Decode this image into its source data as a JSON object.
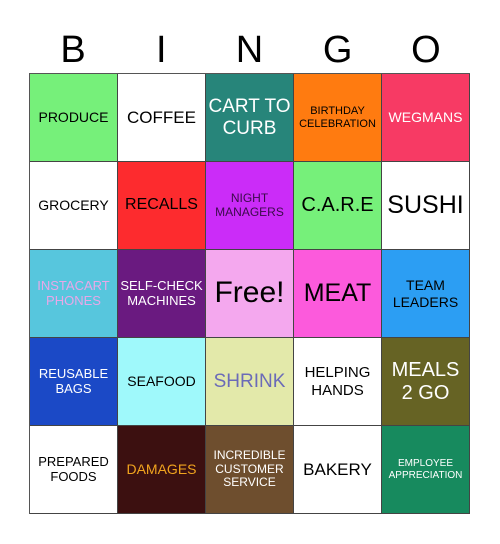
{
  "header": {
    "letters": [
      "B",
      "I",
      "N",
      "G",
      "O"
    ]
  },
  "cells": [
    {
      "label": "PRODUCE",
      "bg": "#76f07a",
      "color": "#000000",
      "size": 14
    },
    {
      "label": "COFFEE",
      "bg": "#ffffff",
      "color": "#000000",
      "size": 17
    },
    {
      "label": "CART TO CURB",
      "bg": "#27857a",
      "color": "#ffffff",
      "size": 19
    },
    {
      "label": "BIRTHDAY CELEBRATION",
      "bg": "#ff7b10",
      "color": "#000000",
      "size": 11
    },
    {
      "label": "WEGMANS",
      "bg": "#f73a64",
      "color": "#ffffff",
      "size": 14
    },
    {
      "label": "GROCERY",
      "bg": "#ffffff",
      "color": "#000000",
      "size": 14
    },
    {
      "label": "RECALLS",
      "bg": "#fd2b2e",
      "color": "#000000",
      "size": 16
    },
    {
      "label": "NIGHT MANAGERS",
      "bg": "#cb2cf8",
      "color": "#3a0a4a",
      "size": 12
    },
    {
      "label": "C.A.R.E",
      "bg": "#76f07a",
      "color": "#000000",
      "size": 20
    },
    {
      "label": "SUSHI",
      "bg": "#ffffff",
      "color": "#000000",
      "size": 25
    },
    {
      "label": "INSTACART PHONES",
      "bg": "#57c6dd",
      "color": "#e8a8e8",
      "size": 13
    },
    {
      "label": "SELF-CHECK MACHINES",
      "bg": "#6a1a80",
      "color": "#ffffff",
      "size": 13
    },
    {
      "label": "Free!",
      "bg": "#f4a8ee",
      "color": "#000000",
      "size": 30
    },
    {
      "label": "MEAT",
      "bg": "#fc5adc",
      "color": "#000000",
      "size": 25
    },
    {
      "label": "TEAM LEADERS",
      "bg": "#2c9ef3",
      "color": "#000000",
      "size": 14
    },
    {
      "label": "REUSABLE BAGS",
      "bg": "#1b49c6",
      "color": "#ffffff",
      "size": 13
    },
    {
      "label": "SEAFOOD",
      "bg": "#9ff9fb",
      "color": "#000000",
      "size": 14
    },
    {
      "label": "SHRINK",
      "bg": "#e3e9aa",
      "color": "#6b6bb8",
      "size": 19
    },
    {
      "label": "HELPING HANDS",
      "bg": "#ffffff",
      "color": "#000000",
      "size": 15
    },
    {
      "label": "MEALS 2 GO",
      "bg": "#666324",
      "color": "#ffffff",
      "size": 20
    },
    {
      "label": "PREPARED FOODS",
      "bg": "#ffffff",
      "color": "#000000",
      "size": 13
    },
    {
      "label": "DAMAGES",
      "bg": "#3c1010",
      "color": "#f1a41e",
      "size": 14
    },
    {
      "label": "INCREDIBLE CUSTOMER SERVICE",
      "bg": "#6e4e2e",
      "color": "#ffffff",
      "size": 12
    },
    {
      "label": "BAKERY",
      "bg": "#ffffff",
      "color": "#000000",
      "size": 17
    },
    {
      "label": "EMPLOYEE APPRECIATION",
      "bg": "#178a5e",
      "color": "#ffffff",
      "size": 10
    }
  ]
}
